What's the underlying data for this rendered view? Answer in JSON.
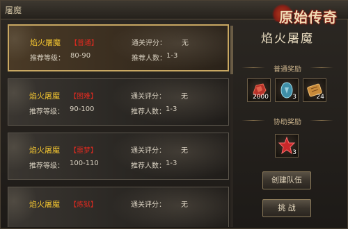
{
  "window": {
    "title": "屠魔"
  },
  "logo": {
    "text": "原始传奇"
  },
  "dungeons": [
    {
      "name": "焰火屠魔",
      "difficulty": "【普通】",
      "score_label": "通关评分：",
      "score_value": "无",
      "level_label": "推荐等级：",
      "level_value": "80-90",
      "players_label": "推荐人数：",
      "players_value": "1-3"
    },
    {
      "name": "焰火屠魔",
      "difficulty": "【困难】",
      "score_label": "通关评分：",
      "score_value": "无",
      "level_label": "推荐等级：",
      "level_value": "90-100",
      "players_label": "推荐人数：",
      "players_value": "1-3"
    },
    {
      "name": "焰火屠魔",
      "difficulty": "【噩梦】",
      "score_label": "通关评分：",
      "score_value": "无",
      "level_label": "推荐等级：",
      "level_value": "100-110",
      "players_label": "推荐人数：",
      "players_value": "1-3"
    },
    {
      "name": "焰火屠魔",
      "difficulty": "【炼狱】",
      "score_label": "通关评分：",
      "score_value": "无"
    }
  ],
  "panel": {
    "dungeon_name": "焰火屠魔",
    "normal_reward_title": "普通奖励",
    "normal_rewards": [
      {
        "icon": "red-ore-icon",
        "count": "2000"
      },
      {
        "icon": "blue-gem-icon",
        "count": "3"
      },
      {
        "icon": "scroll-icon",
        "count": "24"
      }
    ],
    "assist_reward_title": "协助奖励",
    "assist_rewards": [
      {
        "icon": "red-star-icon",
        "count": "3"
      }
    ],
    "create_team_label": "创建队伍",
    "challenge_label": "挑 战"
  },
  "colors": {
    "accent_gold": "#f2c430",
    "difficulty_red": "#e02a20",
    "selected_border": "#c9a862"
  }
}
